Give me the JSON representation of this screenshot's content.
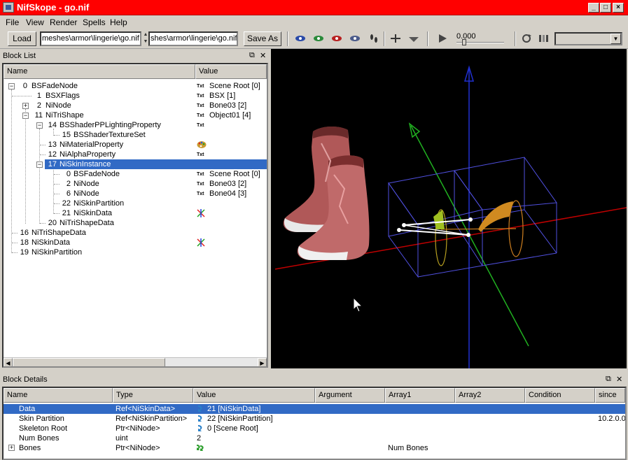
{
  "window": {
    "title": "NifSkope - go.nif"
  },
  "menu": [
    "File",
    "View",
    "Render",
    "Spells",
    "Help"
  ],
  "toolbar": {
    "load_label": "Load",
    "load_path": "meshes\\armor\\lingerie\\go.nif",
    "save_path": "shes\\armor\\lingerie\\go.nif",
    "saveas_label": "Save As",
    "time_value": "0.000"
  },
  "blocklist": {
    "title": "Block List",
    "col_name": "Name",
    "col_value": "Value",
    "rows": [
      {
        "num": "0",
        "name": "BSFadeNode",
        "txt": "Txt",
        "value": "Scene Root [0]"
      },
      {
        "num": "1",
        "name": "BSXFlags",
        "txt": "Txt",
        "value": "BSX [1]"
      },
      {
        "num": "2",
        "name": "NiNode",
        "txt": "Txt",
        "value": "Bone03 [2]"
      },
      {
        "num": "11",
        "name": "NiTriShape",
        "txt": "Txt",
        "value": "Object01 [4]"
      },
      {
        "num": "14",
        "name": "BSShaderPPLightingProperty",
        "txt": "Txt",
        "value": ""
      },
      {
        "num": "15",
        "name": "BSShaderTextureSet",
        "txt": "",
        "value": ""
      },
      {
        "num": "13",
        "name": "NiMaterialProperty",
        "txt": "",
        "value": ""
      },
      {
        "num": "12",
        "name": "NiAlphaProperty",
        "txt": "Txt",
        "value": ""
      },
      {
        "num": "17",
        "name": "NiSkinInstance",
        "txt": "",
        "value": ""
      },
      {
        "num": "0",
        "name": "BSFadeNode",
        "txt": "Txt",
        "value": "Scene Root [0]"
      },
      {
        "num": "2",
        "name": "NiNode",
        "txt": "Txt",
        "value": "Bone03 [2]"
      },
      {
        "num": "6",
        "name": "NiNode",
        "txt": "Txt",
        "value": "Bone04 [3]"
      },
      {
        "num": "22",
        "name": "NiSkinPartition",
        "txt": "",
        "value": ""
      },
      {
        "num": "21",
        "name": "NiSkinData",
        "txt": "",
        "value": ""
      },
      {
        "num": "20",
        "name": "NiTriShapeData",
        "txt": "",
        "value": ""
      },
      {
        "num": "16",
        "name": "NiTriShapeData",
        "txt": "",
        "value": ""
      },
      {
        "num": "18",
        "name": "NiSkinData",
        "txt": "",
        "value": ""
      },
      {
        "num": "19",
        "name": "NiSkinPartition",
        "txt": "",
        "value": ""
      }
    ]
  },
  "details": {
    "title": "Block Details",
    "columns": [
      "Name",
      "Type",
      "Value",
      "Argument",
      "Array1",
      "Array2",
      "Condition",
      "since"
    ],
    "rows": [
      {
        "name": "Data",
        "type": "Ref<NiSkinData>",
        "value": "21 [NiSkinData]",
        "array1": "",
        "since": ""
      },
      {
        "name": "Skin Partition",
        "type": "Ref<NiSkinPartition>",
        "value": "22 [NiSkinPartition]",
        "array1": "",
        "since": "10.2.0.0"
      },
      {
        "name": "Skeleton Root",
        "type": "Ptr<NiNode>",
        "value": "0 [Scene Root]",
        "array1": "",
        "since": ""
      },
      {
        "name": "Num Bones",
        "type": "uint",
        "value": "2",
        "array1": "",
        "since": ""
      },
      {
        "name": "Bones",
        "type": "Ptr<NiNode>",
        "value": "",
        "array1": "Num Bones",
        "since": ""
      }
    ]
  }
}
